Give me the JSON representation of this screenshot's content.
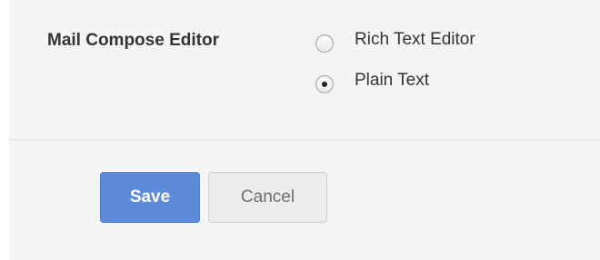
{
  "setting": {
    "label": "Mail Compose Editor",
    "options": [
      {
        "label": "Rich Text Editor",
        "selected": false
      },
      {
        "label": "Plain Text",
        "selected": true
      }
    ]
  },
  "actions": {
    "save_label": "Save",
    "cancel_label": "Cancel"
  },
  "colors": {
    "primary": "#5b8bd9",
    "panel_bg": "#f4f4f4",
    "text": "#333333"
  }
}
